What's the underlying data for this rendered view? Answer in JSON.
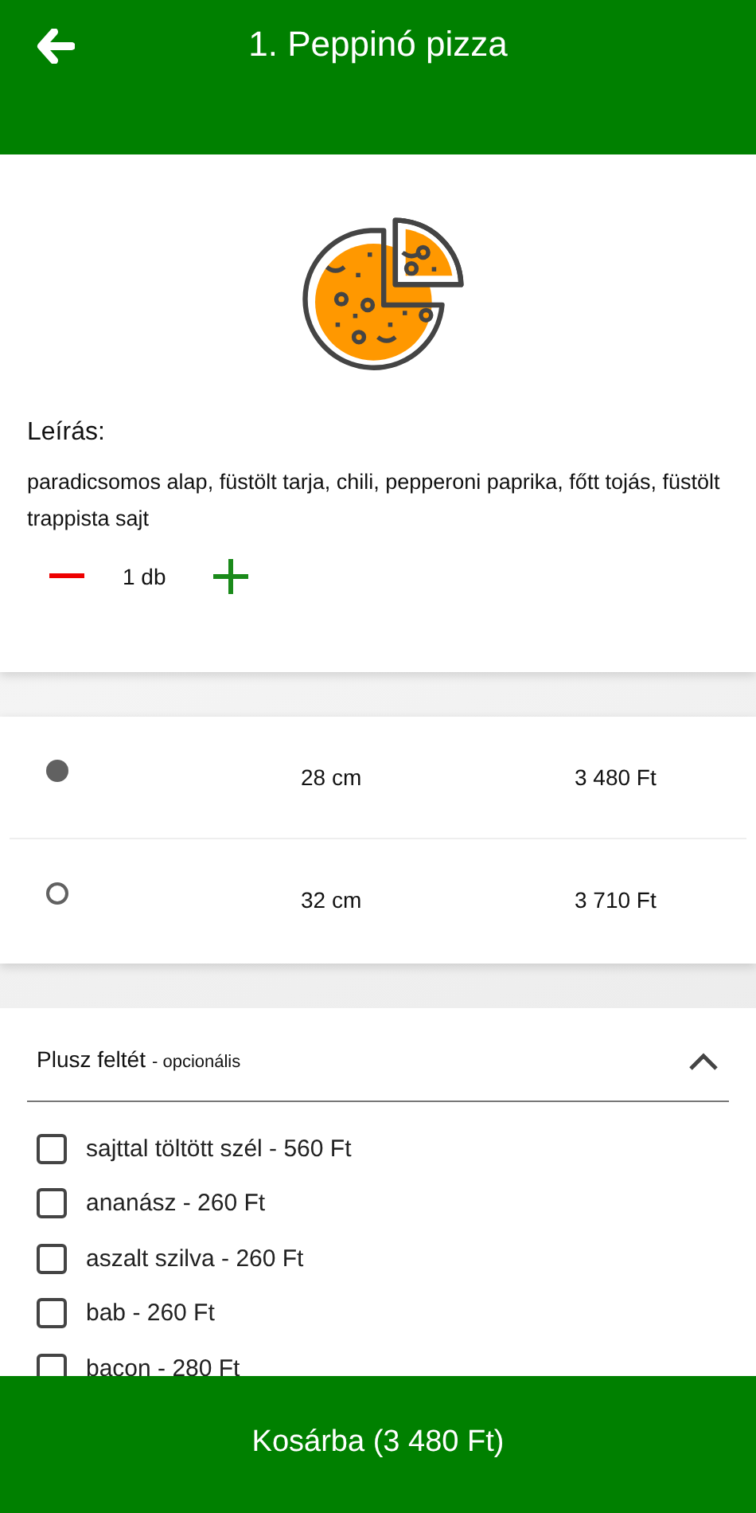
{
  "header": {
    "title": "1. Peppinó pizza"
  },
  "product": {
    "description_label": "Leírás:",
    "description": "paradicsomos alap, füstölt tarja, chili, pepperoni paprika, főtt tojás, füstölt trappista sajt",
    "quantity": "1 db"
  },
  "sizes": [
    {
      "size": "28 cm",
      "price": "3 480 Ft",
      "selected": true
    },
    {
      "size": "32 cm",
      "price": "3 710 Ft",
      "selected": false
    }
  ],
  "extras": {
    "title": "Plusz feltét",
    "note": "- opcionális",
    "expanded": true,
    "items": [
      {
        "label": "sajttal töltött szél - 560 Ft",
        "checked": false
      },
      {
        "label": "ananász - 260 Ft",
        "checked": false
      },
      {
        "label": "aszalt szilva - 260 Ft",
        "checked": false
      },
      {
        "label": "bab - 260 Ft",
        "checked": false
      },
      {
        "label": "bacon - 280 Ft",
        "checked": false
      }
    ]
  },
  "cart_button": "Kosárba (3 480 Ft)"
}
